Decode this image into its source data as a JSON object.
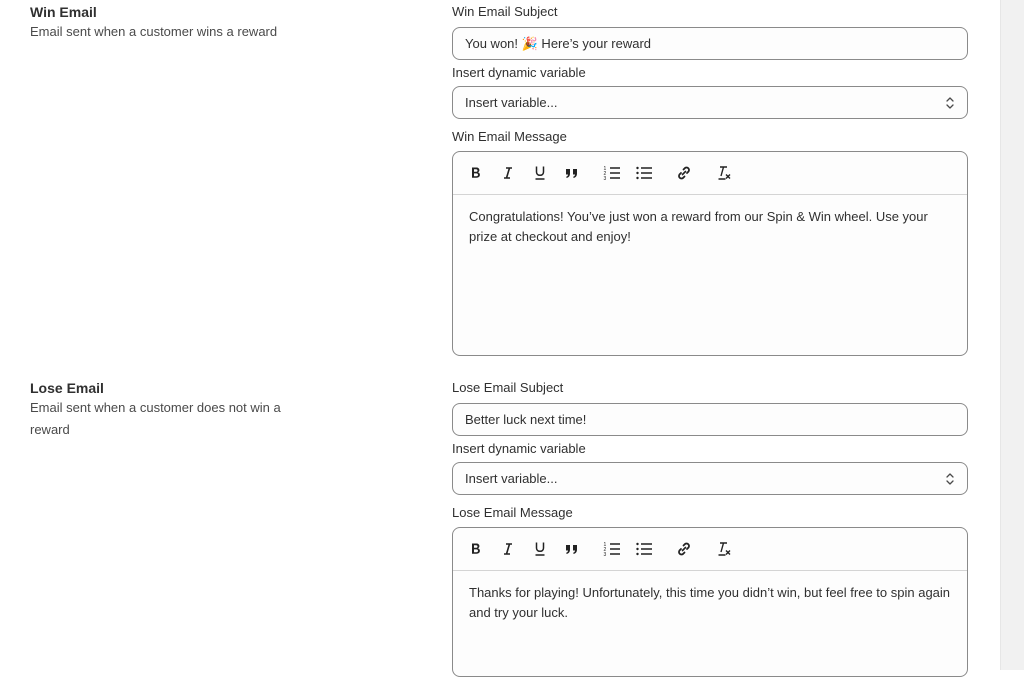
{
  "win": {
    "title": "Win Email",
    "description": "Email sent when a customer wins a reward",
    "subject_label": "Win Email Subject",
    "subject_prefix": "You won! ",
    "subject_emoji": "🎉",
    "subject_suffix": " Here’s your reward",
    "variable_label": "Insert dynamic variable",
    "variable_value": "Insert variable...",
    "message_label": "Win Email Message",
    "message": "Congratulations! You’ve just won a reward from our Spin & Win wheel. Use your prize at checkout and enjoy!"
  },
  "lose": {
    "title": "Lose Email",
    "description": "Email sent when a customer does not win a reward",
    "subject_label": "Lose Email Subject",
    "subject": "Better luck next time!",
    "variable_label": "Insert dynamic variable",
    "variable_value": "Insert variable...",
    "message_label": "Lose Email Message",
    "message": "Thanks for playing! Unfortunately, this time you didn’t win, but feel free to spin again and try your luck."
  },
  "toolbar": {
    "buttons": [
      "bold-icon",
      "italic-icon",
      "underline-icon",
      "quote-icon",
      "ordered-list-icon",
      "bullet-list-icon",
      "link-icon",
      "clear-format-icon"
    ]
  }
}
